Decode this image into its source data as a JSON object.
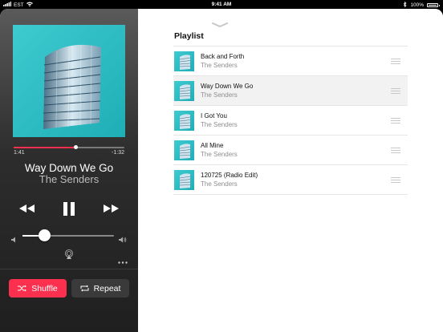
{
  "status_bar": {
    "carrier": "EST",
    "time": "9:41 AM",
    "battery": "100%"
  },
  "player": {
    "progress": 0.56,
    "elapsed": "1:41",
    "remaining": "-1:32",
    "title": "Way Down We Go",
    "artist": "The Senders",
    "volume": 0.24,
    "shuffle_label": "Shuffle",
    "repeat_label": "Repeat",
    "accent_color": "#fb2f4e"
  },
  "playlist": {
    "heading": "Playlist",
    "tracks": [
      {
        "title": "Back and Forth",
        "artist": "The Senders"
      },
      {
        "title": "Way Down We Go",
        "artist": "The Senders"
      },
      {
        "title": "I Got You",
        "artist": "The Senders"
      },
      {
        "title": "All Mine",
        "artist": "The Senders"
      },
      {
        "title": "120725 (Radio Edit)",
        "artist": "The Senders"
      }
    ],
    "selected_index": 1
  },
  "icons": [
    "wifi-icon",
    "bluetooth-icon",
    "battery-icon",
    "chevron-down-icon",
    "rewind-icon",
    "pause-icon",
    "fast-forward-icon",
    "volume-low-icon",
    "volume-high-icon",
    "airplay-icon",
    "more-icon",
    "shuffle-icon",
    "repeat-icon",
    "reorder-grip-icon"
  ]
}
